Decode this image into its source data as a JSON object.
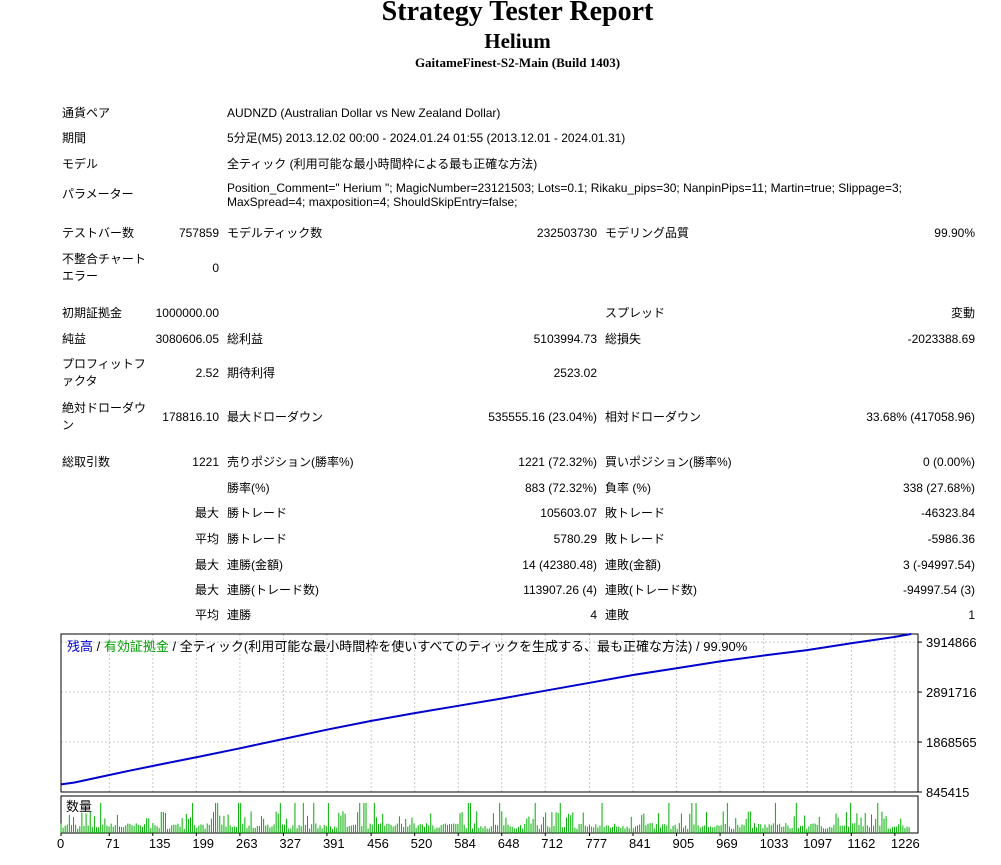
{
  "title": "Strategy Tester Report",
  "ea_name": "Helium",
  "server": "GaitameFinest-S2-Main (Build 1403)",
  "info": {
    "symbol_label": "通貨ペア",
    "symbol_value": "AUDNZD (Australian Dollar vs New Zealand Dollar)",
    "period_label": "期間",
    "period_value": "5分足(M5) 2013.12.02 00:00 - 2024.01.24 01:55 (2013.12.01 - 2024.01.31)",
    "model_label": "モデル",
    "model_value": "全ティック (利用可能な最小時間枠による最も正確な方法)",
    "params_label": "パラメーター",
    "params_value": "Position_Comment=\" Herium \"; MagicNumber=23121503; Lots=0.1; Rikaku_pips=30; NanpinPips=11; Martin=true; Slippage=3; MaxSpread=4; maxposition=4; ShouldSkipEntry=false;"
  },
  "stats": {
    "bars_label": "テストバー数",
    "bars_value": "757859",
    "ticks_label": "モデルティック数",
    "ticks_value": "232503730",
    "quality_label": "モデリング品質",
    "quality_value": "99.90%",
    "mismatch_label": "不整合チャート\nエラー",
    "mismatch_value": "0",
    "deposit_label": "初期証拠金",
    "deposit_value": "1000000.00",
    "spread_label": "スプレッド",
    "spread_value": "変動",
    "net_label": "純益",
    "net_value": "3080606.05",
    "gross_profit_label": "総利益",
    "gross_profit_value": "5103994.73",
    "gross_loss_label": "総損失",
    "gross_loss_value": "-2023388.69",
    "pf_label": "プロフィットフ\nァクタ",
    "pf_value": "2.52",
    "expected_label": "期待利得",
    "expected_value": "2523.02",
    "abs_dd_label": "絶対ドローダウ\nン",
    "abs_dd_value": "178816.10",
    "max_dd_label": "最大ドローダウン",
    "max_dd_value": "535555.16 (23.04%)",
    "rel_dd_label": "相対ドローダウン",
    "rel_dd_value": "33.68% (417058.96)",
    "trades_label": "総取引数",
    "trades_value": "1221",
    "short_label": "売りポジション(勝率%)",
    "short_value": "1221 (72.32%)",
    "long_label": "買いポジション(勝率%)",
    "long_value": "0 (0.00%)",
    "win_label": "勝率(%)",
    "win_value": "883 (72.32%)",
    "loss_label": "負率 (%)",
    "loss_value": "338 (27.68%)",
    "max_word": "最大",
    "avg_word": "平均",
    "largest_win_label": "勝トレード",
    "largest_win_value": "105603.07",
    "largest_loss_label": "敗トレード",
    "largest_loss_value": "-46323.84",
    "avg_win_label": "勝トレード",
    "avg_win_value": "5780.29",
    "avg_loss_label": "敗トレード",
    "avg_loss_value": "-5986.36",
    "max_consec_win_label": "連勝(金額)",
    "max_consec_win_value": "14 (42380.48)",
    "max_consec_loss_label": "連敗(金額)",
    "max_consec_loss_value": "3 (-94997.54)",
    "max_consec_profit_label": "連勝(トレード数)",
    "max_consec_profit_value": "113907.26 (4)",
    "max_consec_lossamt_label": "連敗(トレード数)",
    "max_consec_lossamt_value": "-94997.54 (3)",
    "avg_consec_win_label": "連勝",
    "avg_consec_win_value": "4",
    "avg_consec_loss_label": "連敗",
    "avg_consec_loss_value": "1"
  },
  "chart_legend": {
    "balance": "残高",
    "sep1": " / ",
    "equity": "有効証拠金",
    "rest": " / 全ティック(利用可能な最小時間枠を使いすべてのティックを生成する、最も正確な方法) / 99.90%",
    "volume": "数量"
  },
  "colors": {
    "balance": "#0000cc",
    "equity": "#00a000",
    "volume": "#00b000",
    "grid": "#c8c8c8",
    "frame": "#000000"
  },
  "chart_data": {
    "type": "line",
    "title": "",
    "xlabel": "",
    "ylabel": "",
    "x_ticks": [
      0,
      71,
      135,
      199,
      263,
      327,
      391,
      456,
      520,
      584,
      648,
      712,
      777,
      841,
      905,
      969,
      1033,
      1097,
      1162,
      1226
    ],
    "y_ticks": [
      845415,
      1868565,
      2891716,
      3914866
    ],
    "xlim": [
      0,
      1260
    ],
    "ylim": [
      845415,
      4080000
    ],
    "grid": true,
    "series": [
      {
        "name": "残高",
        "x": [
          0,
          20,
          60,
          100,
          150,
          200,
          263,
          327,
          391,
          456,
          520,
          584,
          648,
          712,
          777,
          841,
          905,
          969,
          1033,
          1097,
          1162,
          1226,
          1250
        ],
        "values": [
          1000000,
          1040000,
          1160000,
          1280000,
          1420000,
          1560000,
          1740000,
          1930000,
          2120000,
          2300000,
          2460000,
          2610000,
          2760000,
          2920000,
          3080000,
          3240000,
          3380000,
          3520000,
          3640000,
          3750000,
          3890000,
          4020000,
          4080000
        ]
      }
    ],
    "volume_name": "数量"
  }
}
